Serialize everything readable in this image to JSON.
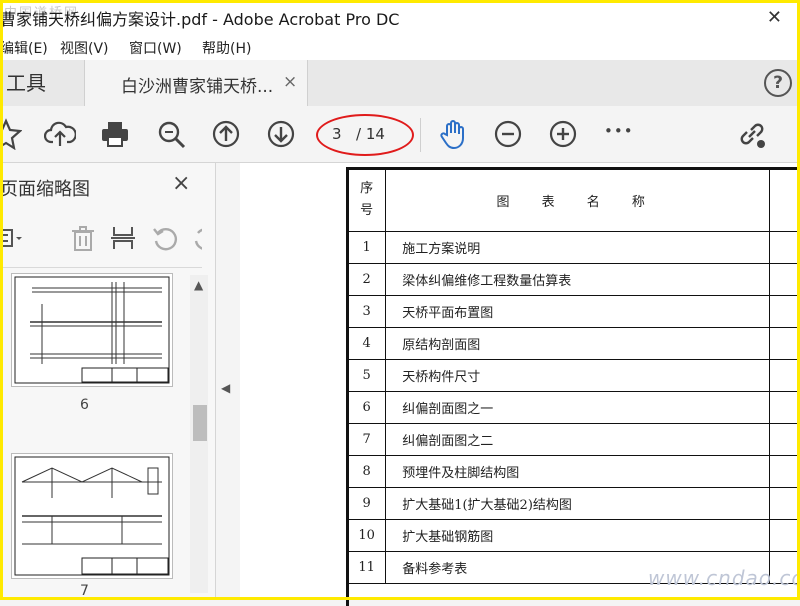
{
  "window": {
    "title": "曹家铺天桥纠偏方案设计.pdf - Adobe Acrobat Pro DC",
    "watermark_top": "中国道桥网"
  },
  "menu": [
    "编辑(E)",
    "视图(V)",
    "窗口(W)",
    "帮助(H)"
  ],
  "tabs": {
    "tools": "工具",
    "document": "白沙洲曹家铺天桥...",
    "close": "×",
    "help": "?"
  },
  "toolbar": {
    "current_page": "3",
    "total_pages": "/ 14",
    "more": "•••"
  },
  "sidebar": {
    "title": "页面缩略图",
    "close": "×",
    "thumbnails": [
      {
        "label": "6"
      },
      {
        "label": "7"
      }
    ]
  },
  "document": {
    "header": {
      "num": "序号",
      "name": "图 表 名 称"
    },
    "rows": [
      {
        "num": "1",
        "name": "施工方案说明"
      },
      {
        "num": "2",
        "name": "梁体纠偏维修工程数量估算表"
      },
      {
        "num": "3",
        "name": "天桥平面布置图"
      },
      {
        "num": "4",
        "name": "原结构剖面图"
      },
      {
        "num": "5",
        "name": "天桥构件尺寸"
      },
      {
        "num": "6",
        "name": "纠偏剖面图之一"
      },
      {
        "num": "7",
        "name": "纠偏剖面图之二"
      },
      {
        "num": "8",
        "name": "预埋件及柱脚结构图"
      },
      {
        "num": "9",
        "name": "扩大基础1(扩大基础2)结构图"
      },
      {
        "num": "10",
        "name": "扩大基础钢筋图"
      },
      {
        "num": "11",
        "name": "备料参考表"
      }
    ]
  },
  "watermark_bottom": "www.cndao.com",
  "colors": {
    "accent": "#2b6fc7",
    "highlight_ring": "#e01b1b",
    "frame": "#ffea00"
  }
}
